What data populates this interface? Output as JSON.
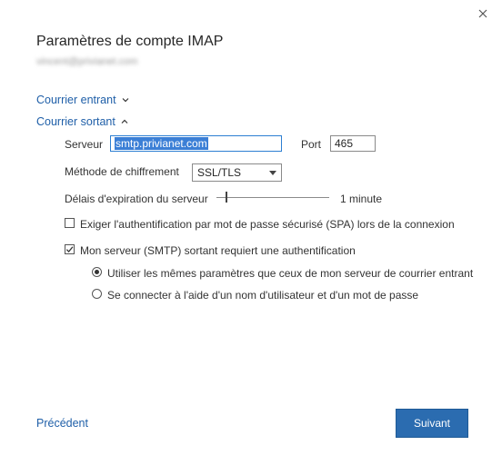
{
  "dialog": {
    "title": "Paramètres de compte IMAP",
    "email": "vincent@privianet.com",
    "close_icon": "close-icon"
  },
  "incoming": {
    "label": "Courrier entrant",
    "icon": "chevron-down-icon"
  },
  "outgoing": {
    "label": "Courrier sortant",
    "icon": "chevron-up-icon",
    "server_label": "Serveur",
    "server_value": "smtp.privianet.com",
    "port_label": "Port",
    "port_value": "465",
    "encryption_label": "Méthode de chiffrement",
    "encryption_value": "SSL/TLS",
    "timeout_label": "Délais d'expiration du serveur",
    "timeout_value": "1 minute",
    "spa_label": "Exiger l'authentification par mot de passe sécurisé (SPA) lors de la connexion",
    "spa_checked": false,
    "auth_label": "Mon serveur (SMTP) sortant requiert une authentification",
    "auth_checked": true,
    "radio_same_label": "Utiliser les mêmes paramètres que ceux de mon serveur de courrier entrant",
    "radio_same_selected": true,
    "radio_login_label": "Se connecter à l'aide d'un nom d'utilisateur et d'un mot de passe",
    "radio_login_selected": false
  },
  "footer": {
    "back_label": "Précédent",
    "next_label": "Suivant"
  },
  "colors": {
    "accent": "#2b6cb0",
    "link": "#1f5fa8",
    "selection": "#3b7fd6"
  }
}
